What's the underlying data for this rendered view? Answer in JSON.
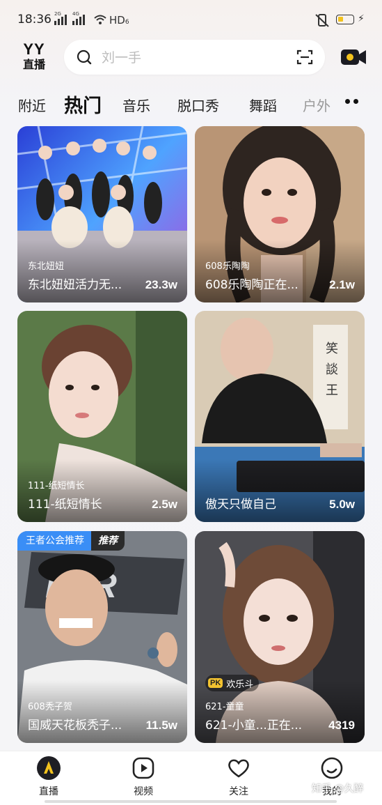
{
  "status_bar": {
    "time": "18:36",
    "sim1": "2G",
    "sim2": "4G",
    "network": "HD",
    "network_suffix": "6"
  },
  "header": {
    "logo_top": "YY",
    "logo_bottom": "直播",
    "search_placeholder": "刘一手"
  },
  "tabs": [
    {
      "label": "附近"
    },
    {
      "label": "热门",
      "active": true
    },
    {
      "label": "音乐"
    },
    {
      "label": "脱口秀"
    },
    {
      "label": "舞蹈"
    },
    {
      "label": "户外"
    }
  ],
  "cards": [
    {
      "anchor": "东北妞妞",
      "title": "东北妞妞活力无...",
      "views": "23.3w"
    },
    {
      "anchor": "608乐陶陶",
      "title": "608乐陶陶正在...",
      "views": "2.1w"
    },
    {
      "anchor": "111-纸短情长",
      "title": "111-纸短情长",
      "views": "2.5w"
    },
    {
      "anchor": "",
      "title": "傲天只做自己",
      "views": "5.0w"
    },
    {
      "anchor": "608秃子贺",
      "title": "国威天花板秃子...",
      "views": "11.5w",
      "badge_left": "王者公会推荐",
      "badge_right": "推荐"
    },
    {
      "anchor": "621-童童",
      "title": "621-小童...正在...",
      "views": "4319",
      "pk_icon": "PK",
      "pk_label": "欢乐斗"
    }
  ],
  "card_images": [
    "group-of-girls-neon-stage",
    "girl-with-braids",
    "girl-outdoors-greenery",
    "bald-man-at-keyboard",
    "man-in-cap-poster",
    "girl-long-brown-hair"
  ],
  "nav": [
    {
      "label": "直播",
      "icon": "live-icon",
      "active": true
    },
    {
      "label": "视频",
      "icon": "video-play-icon"
    },
    {
      "label": "关注",
      "icon": "heart-icon"
    },
    {
      "label": "我的",
      "icon": "profile-icon"
    }
  ],
  "watermark": "知乎 @久醉",
  "colors": {
    "accent_yellow": "#f3c21d",
    "badge_blue": "#3a8ef6",
    "badge_dark": "#2b2b2b"
  }
}
